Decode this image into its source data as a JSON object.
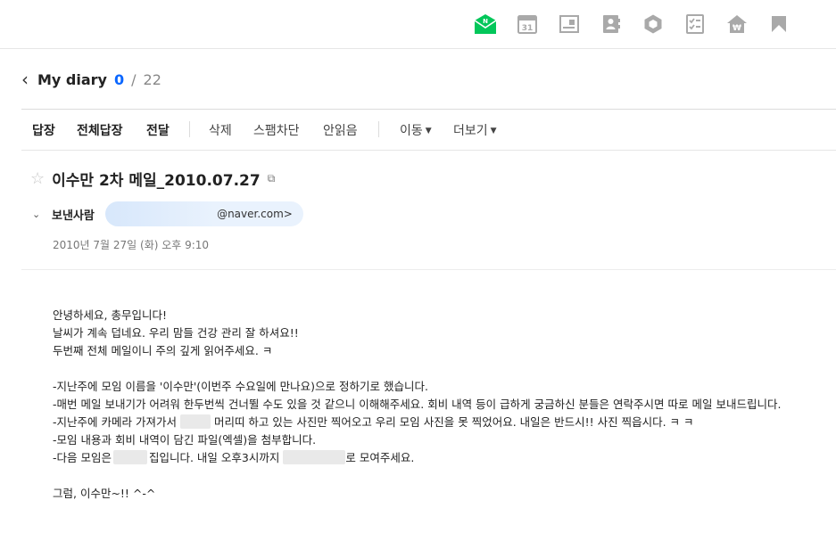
{
  "app_icons": [
    {
      "name": "naver-mail-icon",
      "color": "#03c75a",
      "label": "N"
    },
    {
      "name": "calendar-icon",
      "color": "#a9a9a9",
      "label": "31"
    },
    {
      "name": "notes-icon",
      "color": "#a9a9a9"
    },
    {
      "name": "contacts-icon",
      "color": "#a9a9a9"
    },
    {
      "name": "box-icon",
      "color": "#a9a9a9"
    },
    {
      "name": "tasks-icon",
      "color": "#a9a9a9"
    },
    {
      "name": "home-won-icon",
      "color": "#a9a9a9",
      "label": "₩"
    },
    {
      "name": "bookmark-icon",
      "color": "#a9a9a9"
    }
  ],
  "header": {
    "title": "My diary",
    "unread": "0",
    "separator": "/",
    "total": "22"
  },
  "toolbar": {
    "reply": "답장",
    "reply_all": "전체답장",
    "forward": "전달",
    "delete": "삭제",
    "spam_block": "스팸차단",
    "mark_unread": "안읽음",
    "move": "이동",
    "more": "더보기"
  },
  "mail": {
    "subject": "이수만 2차 메일_2010.07.27",
    "sender_label": "보낸사람",
    "sender_email": "@naver.com>",
    "date": "2010년 7월 27일 (화) 오후 9:10"
  },
  "body": {
    "l1": "안녕하세요, 총무입니다!",
    "l2": "날씨가 계속 덥네요. 우리 맘들 건강 관리 잘 하셔요!!",
    "l3": "두번째 전체 메일이니 주의 깊게 읽어주세요. ㅋ",
    "l4": "-지난주에 모임 이름을 '이수만'(이번주 수요일에 만나요)으로 정하기로 했습니다.",
    "l5": "-매번 메일 보내기가 어려워 한두번씩 건너뛸 수도 있을 것 같으니 이해해주세요. 회비 내역 등이 급하게 궁금하신 분들은 연락주시면 따로 메일 보내드립니다.",
    "l6a": "-지난주에 카메라 가져가서",
    "l6b": "머리띠 하고 있는 사진만 찍어오고 우리 모임 사진을 못 찍었어요. 내일은 반드시!! 사진 찍읍시다. ㅋ ㅋ",
    "l7": "-모임 내용과 회비 내역이 담긴 파일(엑셀)을 첨부합니다.",
    "l8a": "-다음 모임은",
    "l8b": "집입니다. 내일  오후3시까지",
    "l8c": "로 모여주세요.",
    "l9": "그럼, 이수만~!! ^-^"
  }
}
